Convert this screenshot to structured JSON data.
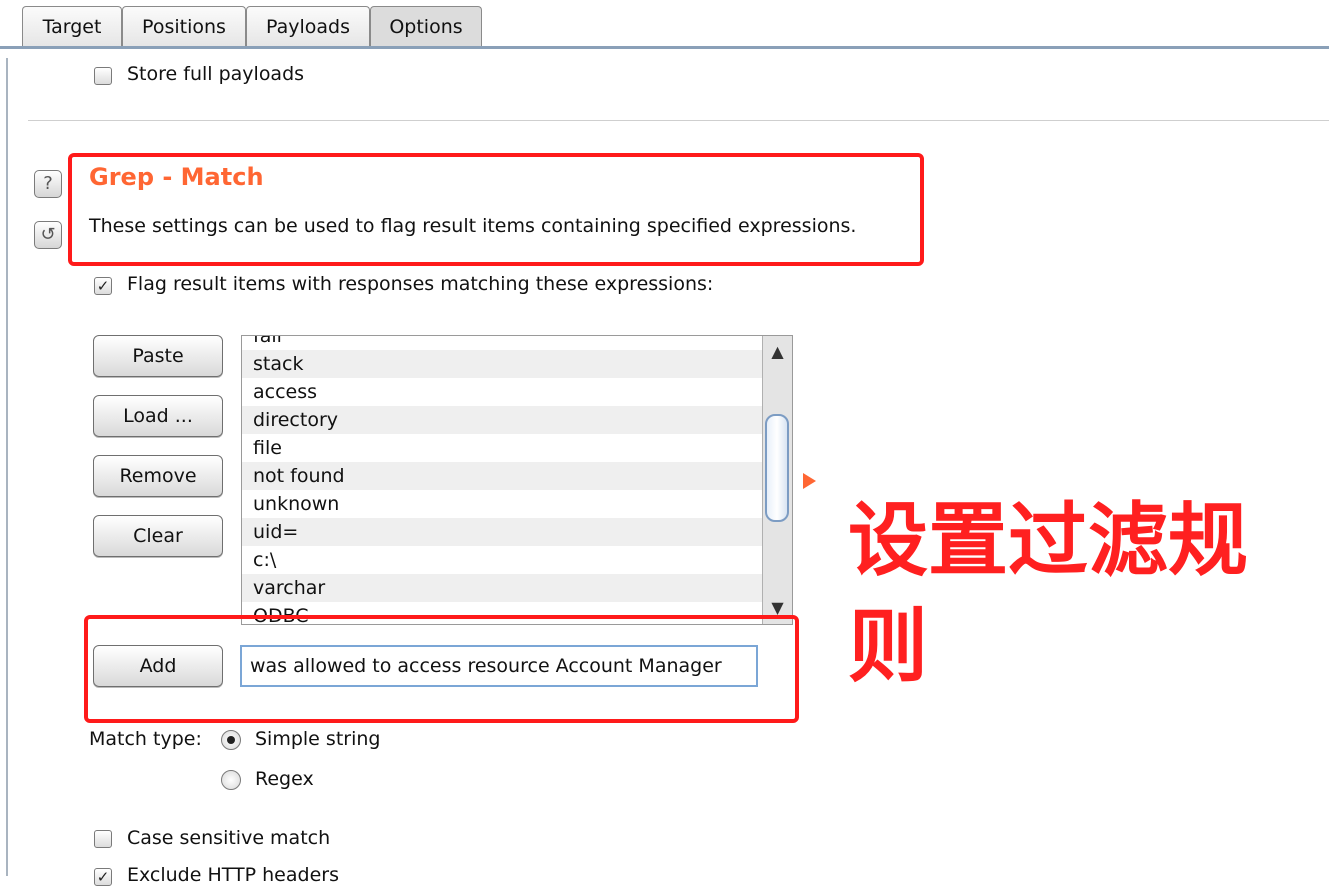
{
  "tabs": [
    {
      "label": "Target"
    },
    {
      "label": "Positions"
    },
    {
      "label": "Payloads"
    },
    {
      "label": "Options"
    }
  ],
  "store_full_payloads": {
    "label": "Store full payloads",
    "checked": false
  },
  "grep_match": {
    "title": "Grep - Match",
    "description": "These settings can be used to flag result items containing specified expressions.",
    "flag_checkbox": {
      "label": "Flag result items with responses matching these expressions:",
      "checked": true
    },
    "buttons": {
      "paste": "Paste",
      "load": "Load ...",
      "remove": "Remove",
      "clear": "Clear",
      "add": "Add"
    },
    "expressions": [
      "fail",
      "stack",
      "access",
      "directory",
      "file",
      "not found",
      "unknown",
      "uid=",
      "c:\\",
      "varchar",
      "ODBC"
    ],
    "add_input_value": "was allowed to access resource Account Manager",
    "match_type": {
      "label": "Match type:",
      "options": [
        {
          "label": "Simple string",
          "selected": true
        },
        {
          "label": "Regex",
          "selected": false
        }
      ]
    },
    "case_sensitive": {
      "label": "Case sensitive match",
      "checked": false
    },
    "exclude_http_headers": {
      "label": "Exclude HTTP headers",
      "checked": true
    }
  },
  "annotation": {
    "text": "设置过滤规则",
    "color": "#ff2020"
  },
  "colors": {
    "title": "#ff6633",
    "highlight_box": "#ff1a1a",
    "tab_line": "#8aa0b8"
  },
  "icons": {
    "help": "help-icon",
    "reset": "reset-icon"
  }
}
